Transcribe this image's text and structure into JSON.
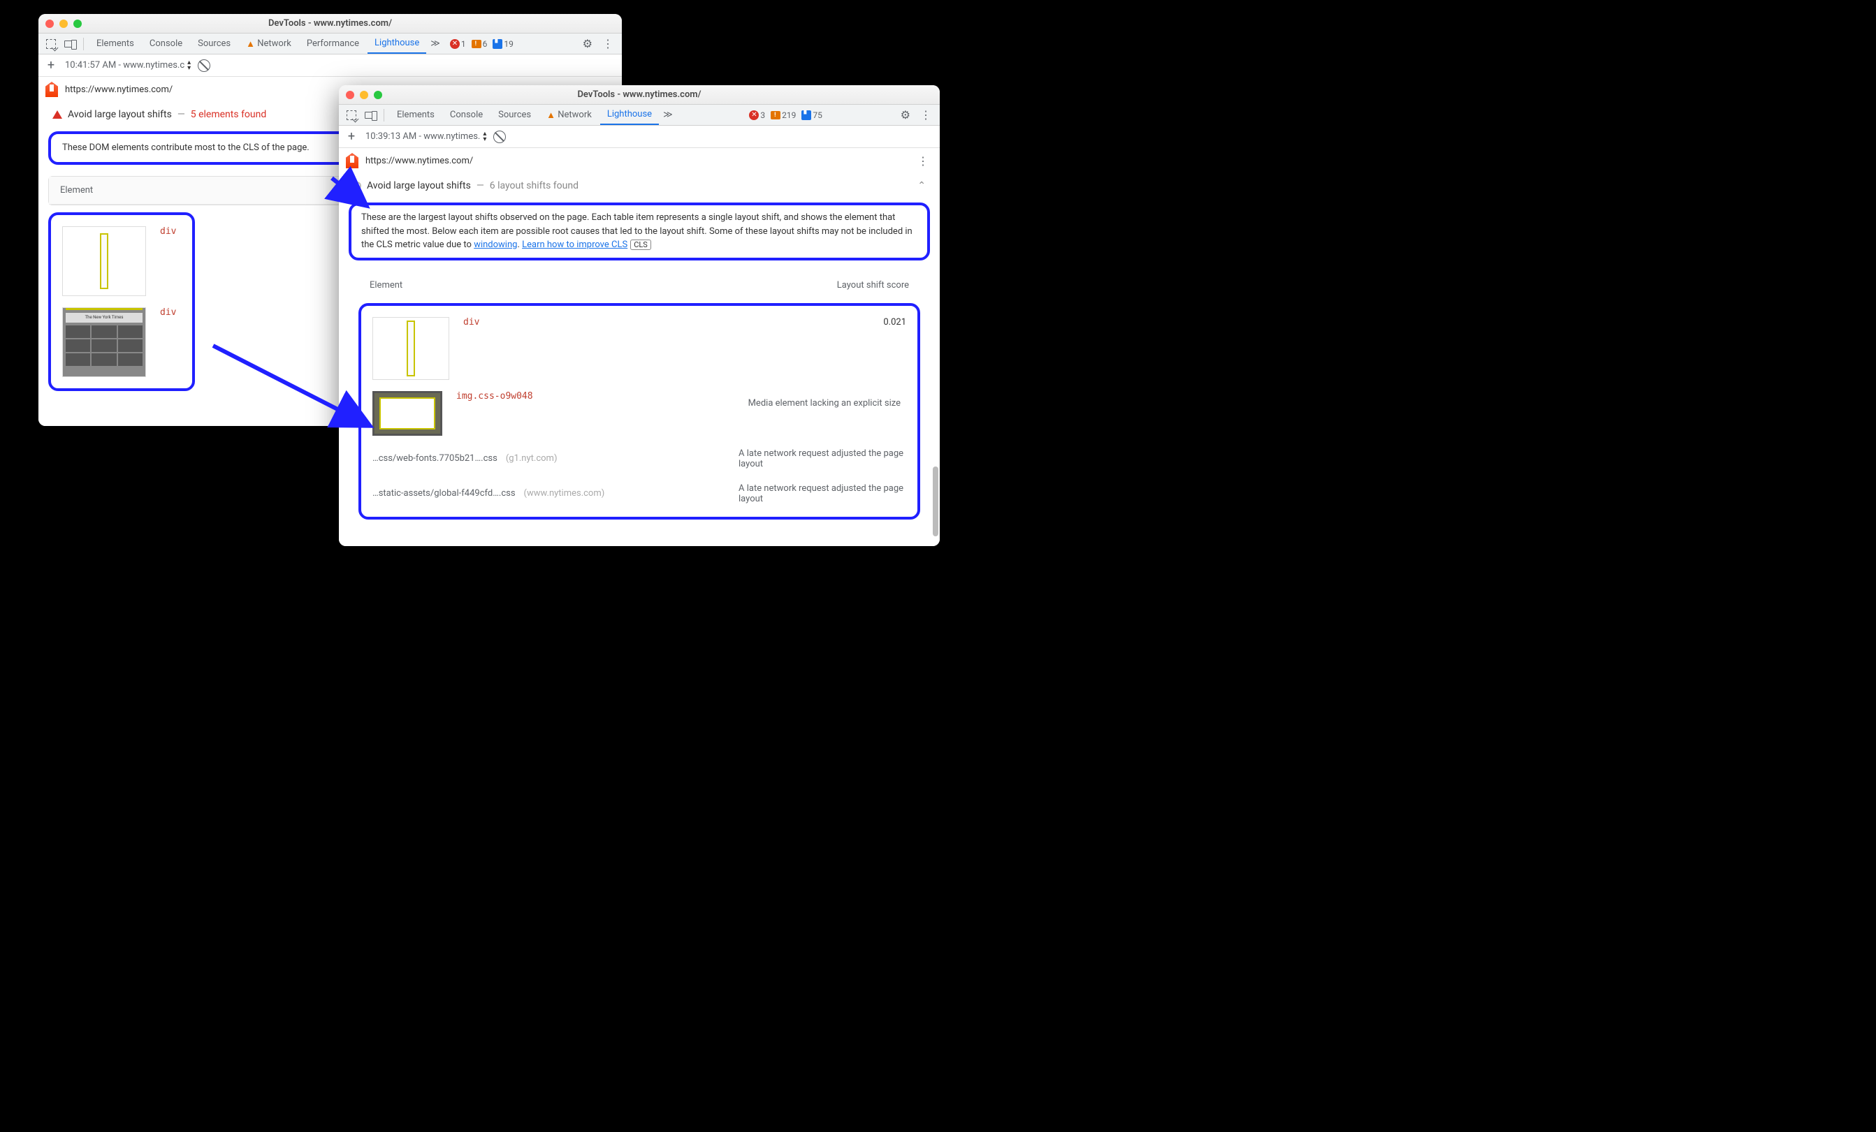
{
  "left": {
    "title": "DevTools - www.nytimes.com/",
    "tabs": [
      "Elements",
      "Console",
      "Sources",
      "Network",
      "Performance",
      "Lighthouse"
    ],
    "network_warn": true,
    "active_tab": "Lighthouse",
    "errors": 1,
    "warnings": 6,
    "issues": 19,
    "run_label": "10:41:57 AM - www.nytimes.c",
    "url": "https://www.nytimes.com/",
    "audit": {
      "title": "Avoid large layout shifts",
      "found": "5 elements found"
    },
    "desc": "These DOM elements contribute most to the CLS of the page.",
    "table_header": "Element",
    "rows": [
      {
        "el": "div"
      },
      {
        "el": "div"
      }
    ]
  },
  "right": {
    "title": "DevTools - www.nytimes.com/",
    "tabs": [
      "Elements",
      "Console",
      "Sources",
      "Network",
      "Lighthouse"
    ],
    "network_warn": true,
    "active_tab": "Lighthouse",
    "errors": 3,
    "warnings": 219,
    "issues": 75,
    "run_label": "10:39:13 AM - www.nytimes.",
    "url": "https://www.nytimes.com/",
    "audit": {
      "title": "Avoid large layout shifts",
      "found": "6 layout shifts found"
    },
    "desc_pre": "These are the largest layout shifts observed on the page. Each table item represents a single layout shift, and shows the element that shifted the most. Below each item are possible root causes that led to the layout shift. Some of these layout shifts may not be included in the CLS metric value due to ",
    "link1": "windowing",
    "desc_mid": ". ",
    "link2": "Learn how to improve CLS",
    "cls_chip": "CLS",
    "table_headers": {
      "left": "Element",
      "right": "Layout shift score"
    },
    "row1": {
      "el": "div",
      "score": "0.021"
    },
    "row2": {
      "el": "img.css-o9w048",
      "reason": "Media element lacking an explicit size"
    },
    "row3": {
      "src": "…css/web-fonts.7705b21….css",
      "host": "(g1.nyt.com)",
      "reason": "A late network request adjusted the page layout"
    },
    "row4": {
      "src": "…static-assets/global-f449cfd….css",
      "host": "(www.nytimes.com)",
      "reason": "A late network request adjusted the page layout"
    }
  }
}
